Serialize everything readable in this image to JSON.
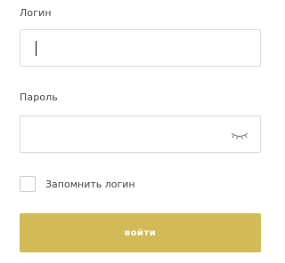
{
  "form": {
    "login_label": "Логин",
    "login_value": "",
    "password_label": "Пароль",
    "password_value": "",
    "password_toggle_icon": "closed-eye-icon",
    "remember_label": "Запомнить логин",
    "remember_checked": false,
    "submit_label": "войти"
  },
  "colors": {
    "accent": "#d2bb57",
    "border": "#d9d9d9",
    "label_text": "#4a4a4a"
  }
}
